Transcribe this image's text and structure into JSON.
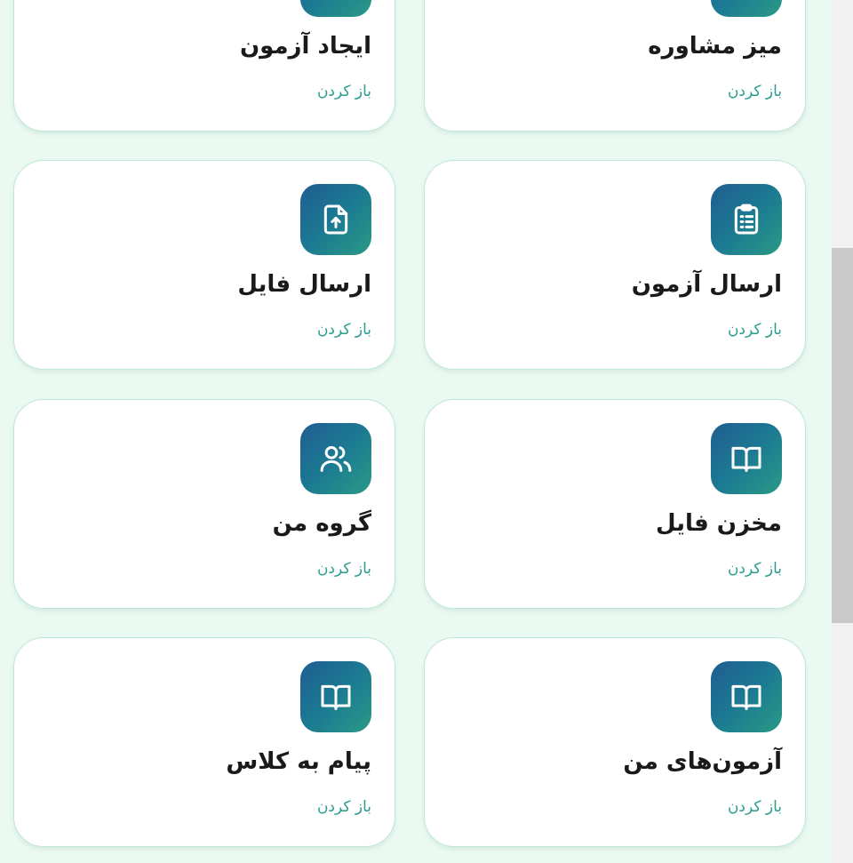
{
  "common": {
    "open_label": "باز کردن"
  },
  "cards": [
    {
      "title": "میز مشاوره",
      "icon": "calendar-icon"
    },
    {
      "title": "ایجاد آزمون",
      "icon": "pencil-icon"
    },
    {
      "title": "ارسال آزمون",
      "icon": "clipboard-list-icon"
    },
    {
      "title": "ارسال فایل",
      "icon": "file-upload-icon"
    },
    {
      "title": "مخزن فایل",
      "icon": "book-open-icon"
    },
    {
      "title": "گروه من",
      "icon": "users-icon"
    },
    {
      "title": "آزمون‌های من",
      "icon": "book-open-icon"
    },
    {
      "title": "پیام به کلاس",
      "icon": "book-open-icon"
    }
  ],
  "colors": {
    "page_bg": "#eaf9f1",
    "accent": "#2a9d8f",
    "icon_gradient_start": "#1f5d91",
    "icon_gradient_end": "#2a9a86"
  }
}
